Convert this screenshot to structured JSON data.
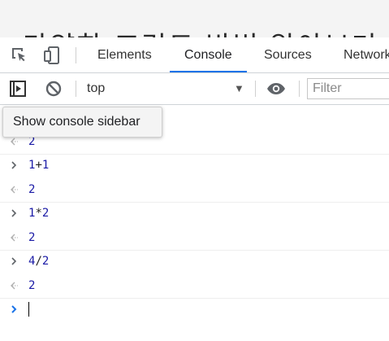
{
  "page": {
    "heading": "다양한 프린트 방법 알아보기"
  },
  "devtools": {
    "tabs": [
      {
        "label": "Elements"
      },
      {
        "label": "Console"
      },
      {
        "label": "Sources"
      },
      {
        "label": "Network"
      }
    ],
    "active_tab": "Console",
    "toolbar": {
      "context_value": "top",
      "filter_placeholder": "Filter"
    },
    "tooltip": "Show console sidebar",
    "console": {
      "lines": [
        {
          "kind": "result",
          "text": "2"
        },
        {
          "kind": "command",
          "left": "1",
          "op": "+",
          "right": "1"
        },
        {
          "kind": "result",
          "text": "2"
        },
        {
          "kind": "command",
          "left": "1",
          "op": "*",
          "right": "2"
        },
        {
          "kind": "result",
          "text": "2"
        },
        {
          "kind": "command",
          "left": "4",
          "op": "/",
          "right": "2"
        },
        {
          "kind": "result",
          "text": "2"
        }
      ]
    }
  },
  "colors": {
    "accent": "#1a73e8",
    "result_number": "#1a1aa6"
  }
}
